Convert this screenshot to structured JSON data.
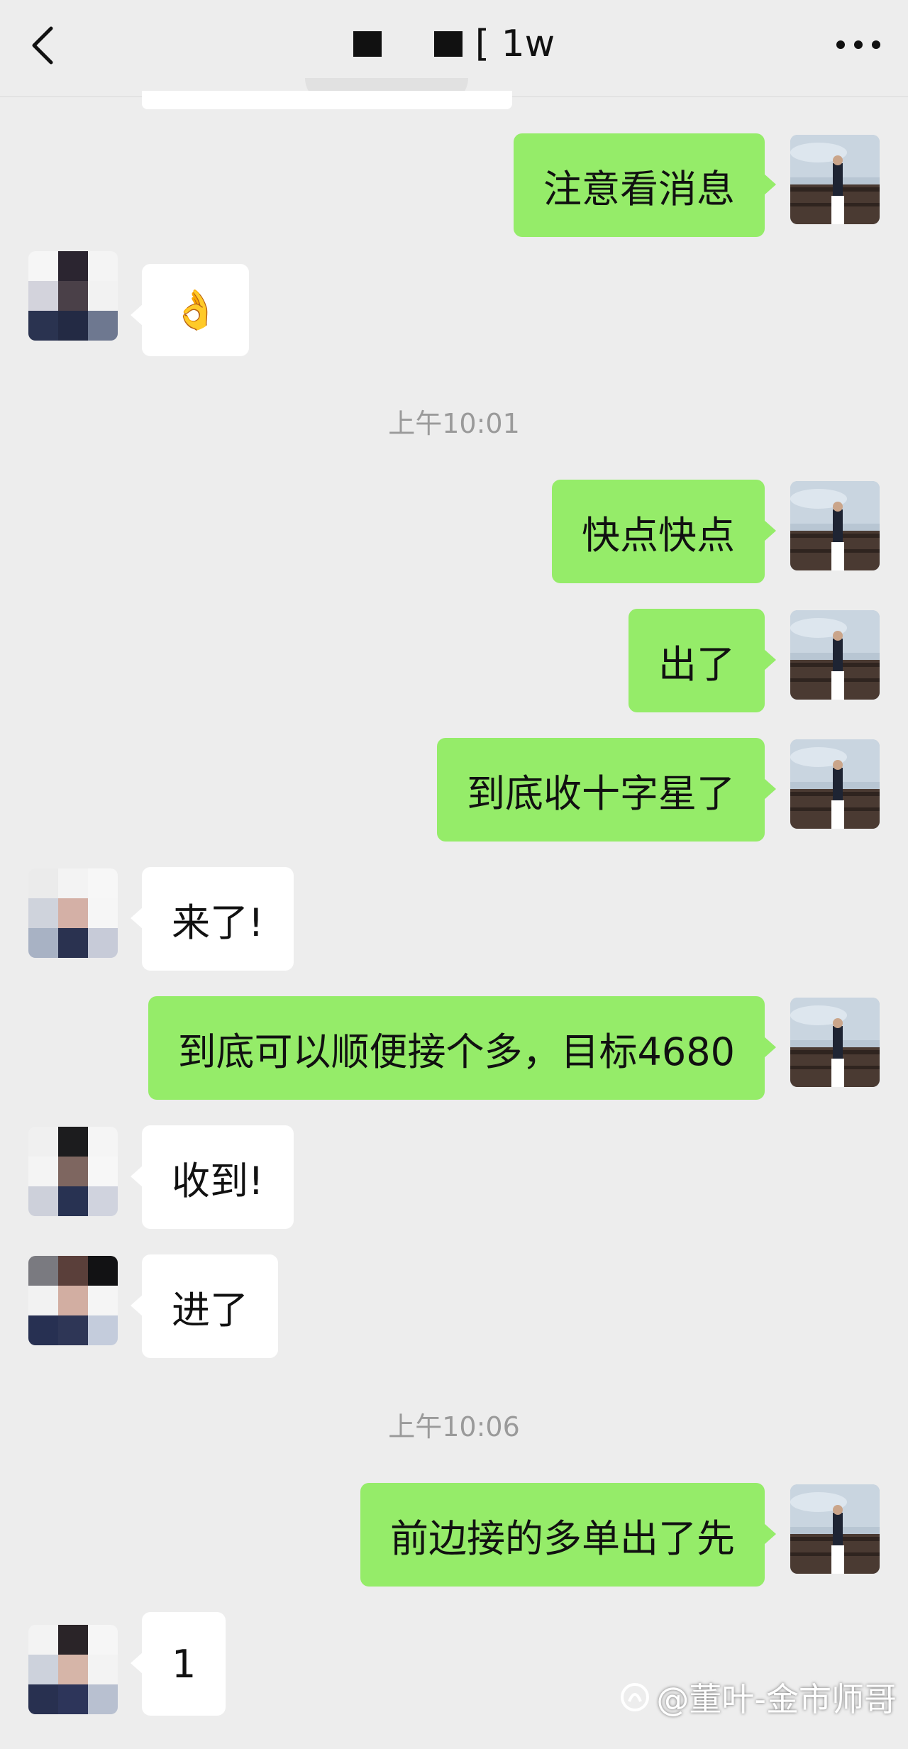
{
  "header": {
    "title_suffix": "[ 1w"
  },
  "messages": [
    {
      "side": "me",
      "text": "注意看消息"
    },
    {
      "side": "them",
      "text": "👌"
    },
    {
      "type": "time",
      "text": "上午10:01"
    },
    {
      "side": "me",
      "text": "快点快点"
    },
    {
      "side": "me",
      "text": "出了"
    },
    {
      "side": "me",
      "text": "到底收十字星了"
    },
    {
      "side": "them",
      "text": "来了!"
    },
    {
      "side": "me",
      "text": "到底可以顺便接个多，目标4680"
    },
    {
      "side": "them",
      "text": "收到!"
    },
    {
      "side": "them",
      "text": "进了"
    },
    {
      "type": "time",
      "text": "上午10:06"
    },
    {
      "side": "me",
      "text": "前边接的多单出了先"
    },
    {
      "side": "them",
      "text": "1"
    }
  ],
  "watermark": {
    "text": "@董叶-金市师哥"
  },
  "icons": {
    "back": "chevron-left-icon",
    "more": "more-dots-icon",
    "watermark_logo": "zhihu-logo-icon"
  },
  "colors": {
    "background": "#ededed",
    "my_bubble": "#95ec69",
    "their_bubble": "#ffffff",
    "timestamp": "#9a9a9a"
  }
}
